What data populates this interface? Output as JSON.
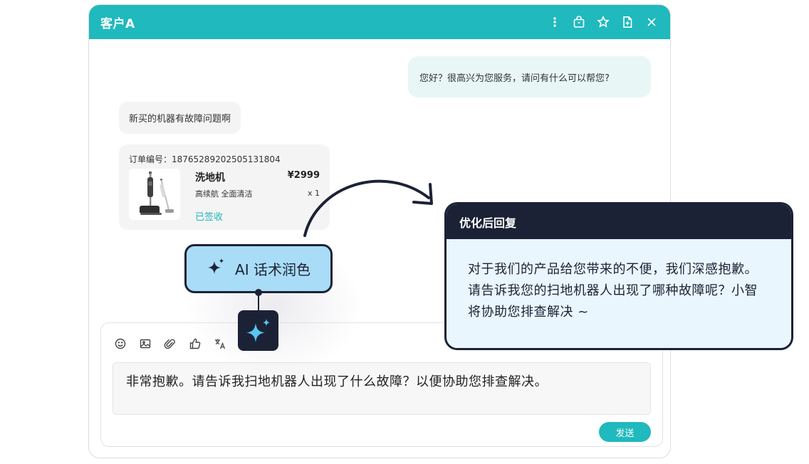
{
  "window": {
    "title": "客户A",
    "toolbar_icons": [
      "more-vertical-icon",
      "bag-icon",
      "star-icon",
      "add-file-icon",
      "close-icon"
    ]
  },
  "messages": {
    "agent_greeting": "您好？很高兴为您服务，请问有什么可以帮您?",
    "customer_message": "新买的机器有故障问题啊"
  },
  "order": {
    "number_label": "订单编号：18765289202505131804",
    "product_name": "洗地机",
    "price": "¥2999",
    "description": "高续航 全面清洁",
    "quantity": "x 1",
    "status": "已签收"
  },
  "composer": {
    "tools": [
      "emoji-icon",
      "image-icon",
      "attachment-icon",
      "thumbs-up-icon",
      "translate-icon"
    ],
    "input_text": "非常抱歉。请告诉我扫地机器人出现了什么故障？以便协助您排查解决。",
    "send_label": "发送"
  },
  "ai_feature": {
    "button_label": "AI 话术润色"
  },
  "optimized_reply": {
    "header": "优化后回复",
    "text": "对于我们的产品给您带来的不便，我们深感抱歉。请告诉我您的扫地机器人出现了哪种故障呢？小智将协助您排查解决 ~"
  },
  "colors": {
    "teal": "#20b9bd",
    "navy": "#1c2236",
    "ai_button_bg": "#a9dcf7",
    "spark_blue": "#5ac4f2",
    "reply_bg": "#eaf6fd"
  }
}
